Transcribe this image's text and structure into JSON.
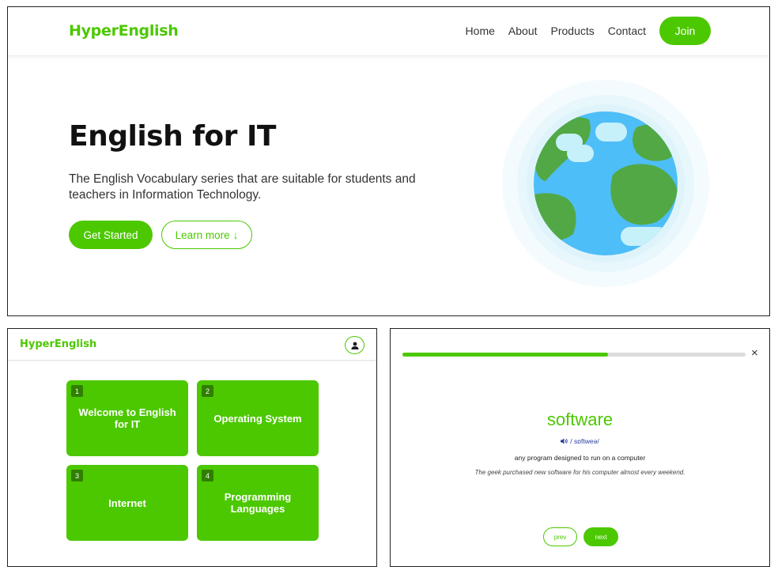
{
  "landing": {
    "logo": "HyperEnglish",
    "nav_links": [
      "Home",
      "About",
      "Products",
      "Contact"
    ],
    "join_label": "Join",
    "hero_title": "English for IT",
    "hero_subtitle": "The English Vocabulary series that are suitable for students and teachers in Information Technology.",
    "get_started_label": "Get Started",
    "learn_more_label": "Learn more",
    "learn_more_icon": "arrow-down-icon"
  },
  "topics": {
    "logo": "HyperEnglish",
    "user_icon": "user-icon",
    "cards": [
      {
        "number": "1",
        "title": "Welcome to English for IT"
      },
      {
        "number": "2",
        "title": "Operating System"
      },
      {
        "number": "3",
        "title": "Internet"
      },
      {
        "number": "4",
        "title": "Programming Languages"
      }
    ]
  },
  "flashcard": {
    "progress": 0.6,
    "close_label": "×",
    "word": "software",
    "phonetic": "/ sɒftweə/",
    "speaker_icon": "speaker-icon",
    "definition": "any program designed to run on a computer",
    "example": "The geek purchased new software for his computer almost every weekend.",
    "prev_label": "prev",
    "next_label": "next"
  },
  "colors": {
    "accent": "#4cc800",
    "accent_dark": "#2f7f00",
    "globe_ocean": "#4dbef7",
    "globe_land": "#52a844",
    "globe_cloud": "#c6f0fa",
    "globe_halo": "#eef9fd"
  }
}
